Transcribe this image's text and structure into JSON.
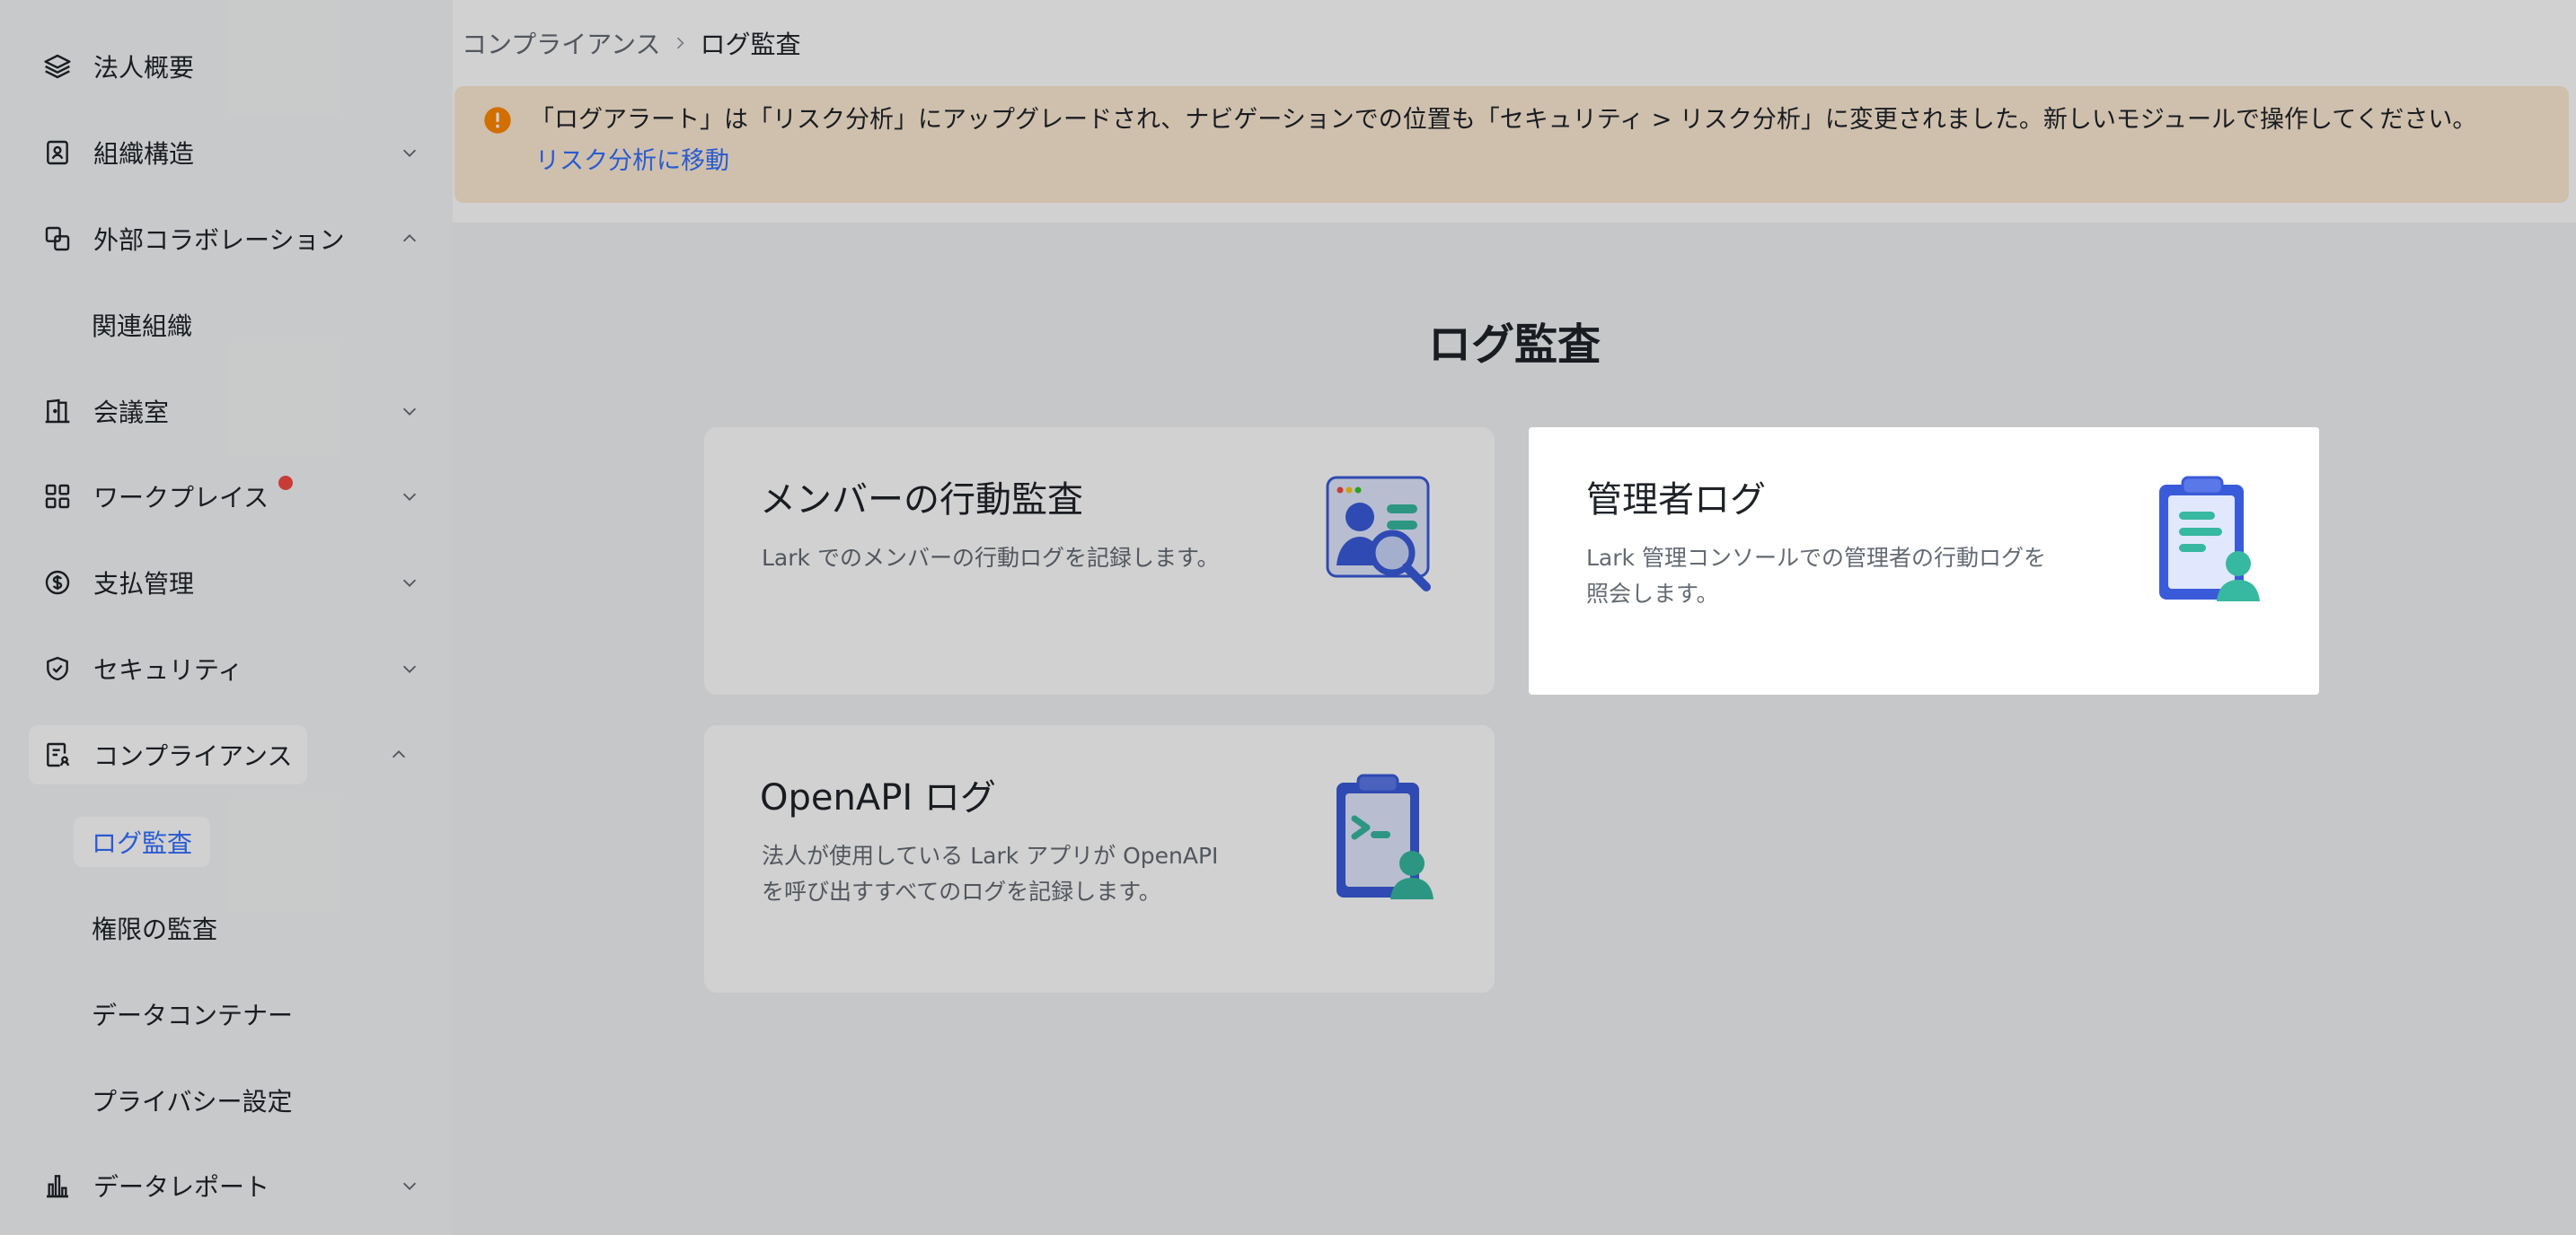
{
  "sidebar": {
    "items": [
      {
        "label": "法人概要",
        "icon": "layers-icon",
        "chevron": "none"
      },
      {
        "label": "組織構造",
        "icon": "org-badge-icon",
        "chevron": "down"
      },
      {
        "label": "外部コラボレーション",
        "icon": "link-squares-icon",
        "chevron": "up"
      },
      {
        "label": "会議室",
        "icon": "door-icon",
        "chevron": "down"
      },
      {
        "label": "ワークプレイス",
        "icon": "grid-icon",
        "chevron": "down",
        "badge": "red-dot"
      },
      {
        "label": "支払管理",
        "icon": "dollar-circle-icon",
        "chevron": "down"
      },
      {
        "label": "セキュリティ",
        "icon": "shield-check-icon",
        "chevron": "down"
      },
      {
        "label": "コンプライアンス",
        "icon": "compliance-doc-icon",
        "chevron": "up"
      },
      {
        "label": "データレポート",
        "icon": "bar-chart-icon",
        "chevron": "down"
      }
    ],
    "external_sub": [
      "関連組織"
    ],
    "compliance_sub": [
      "ログ監査",
      "権限の監査",
      "データコンテナー",
      "プライバシー設定"
    ]
  },
  "breadcrumb": {
    "parent": "コンプライアンス",
    "current": "ログ監査"
  },
  "alert": {
    "message": "「ログアラート」は「リスク分析」にアップグレードされ、ナビゲーションでの位置も「セキュリティ > リスク分析」に変更されました。新しいモジュールで操作してください。",
    "link": "リスク分析に移動"
  },
  "main": {
    "title": "ログ監査",
    "cards": [
      {
        "title": "メンバーの行動監査",
        "desc": "Lark でのメンバーの行動ログを記録します。",
        "icon": "member-search-illustration"
      },
      {
        "title": "管理者ログ",
        "desc": "Lark 管理コンソールでの管理者の行動ログを照会します。",
        "icon": "admin-clipboard-illustration"
      },
      {
        "title": "OpenAPI ログ",
        "desc": "法人が使用している Lark アプリが OpenAPI を呼び出すすべてのログを記録します。",
        "icon": "api-clipboard-illustration"
      }
    ]
  },
  "colors": {
    "accent": "#3370ff",
    "alert_bg": "#fdebd3",
    "warning": "#ff8800",
    "badge": "#f54a45"
  }
}
